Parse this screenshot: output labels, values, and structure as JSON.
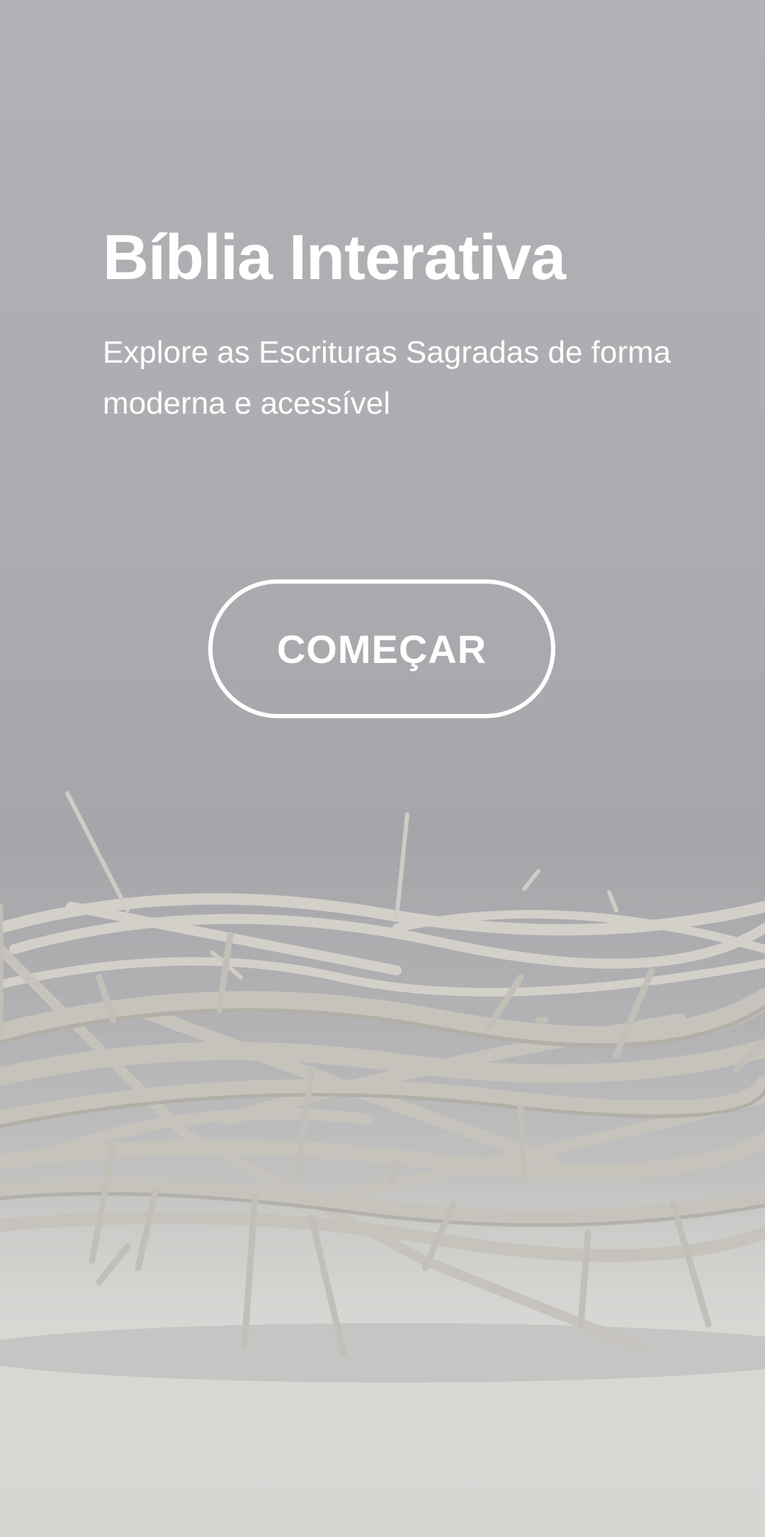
{
  "hero": {
    "title": "Bíblia Interativa",
    "subtitle": "Explore as Escrituras Sagradas de forma moderna e acessível"
  },
  "actions": {
    "start_label": "COMEÇAR"
  },
  "background": {
    "image_icon": "crown-of-thorns-photo"
  },
  "colors": {
    "text": "#ffffff",
    "background": "#aaaaae",
    "branch": "#c9c6bf"
  }
}
